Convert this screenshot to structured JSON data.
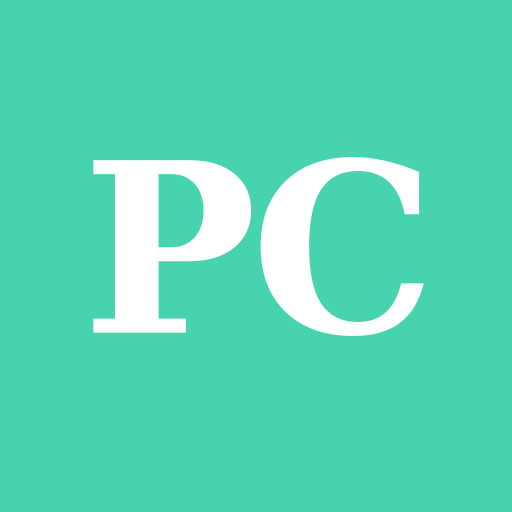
{
  "tile": {
    "background_color": "#47d3ae",
    "text_color": "#ffffff",
    "monogram_text": "PC"
  }
}
